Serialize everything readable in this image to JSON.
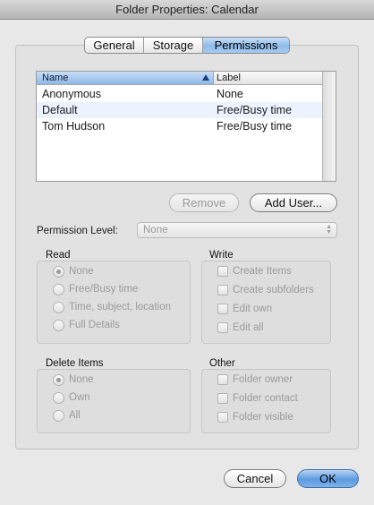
{
  "window": {
    "title": "Folder Properties: Calendar"
  },
  "tabs": [
    {
      "label": "General",
      "active": false
    },
    {
      "label": "Storage",
      "active": false
    },
    {
      "label": "Permissions",
      "active": true
    }
  ],
  "user_list": {
    "columns": {
      "name": "Name",
      "label": "Label"
    },
    "rows": [
      {
        "name": "Anonymous",
        "label": "None"
      },
      {
        "name": "Default",
        "label": "Free/Busy time"
      },
      {
        "name": "Tom Hudson",
        "label": "Free/Busy time"
      }
    ]
  },
  "buttons": {
    "remove": "Remove",
    "add_user": "Add User...",
    "cancel": "Cancel",
    "ok": "OK"
  },
  "permission_level": {
    "label": "Permission Level:",
    "value": "None"
  },
  "read": {
    "title": "Read",
    "options": [
      "None",
      "Free/Busy time",
      "Time, subject, location",
      "Full Details"
    ],
    "selected": "None"
  },
  "write": {
    "title": "Write",
    "options": [
      "Create Items",
      "Create subfolders",
      "Edit own",
      "Edit all"
    ]
  },
  "delete_items": {
    "title": "Delete Items",
    "options": [
      "None",
      "Own",
      "All"
    ],
    "selected": "None"
  },
  "other": {
    "title": "Other",
    "options": [
      "Folder owner",
      "Folder contact",
      "Folder visible"
    ]
  },
  "colors": {
    "accent": "#8fbbea",
    "default_button": "#5e9ae0",
    "disabled_text": "#9a9a9a"
  }
}
